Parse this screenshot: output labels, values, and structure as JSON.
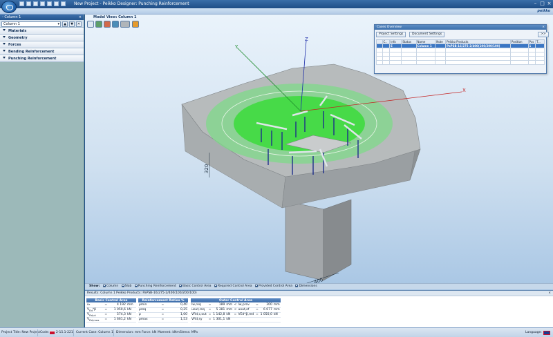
{
  "window": {
    "title": "New Project - Peikko Designer: Punching Reinforcement",
    "brand": "peikko"
  },
  "left_panel": {
    "header": "- Column 1",
    "close": "×",
    "selected_column": "Column 1",
    "sections": [
      "Materials",
      "Geometry",
      "Forces",
      "Bending Reinforcement",
      "Punching Reinforcement"
    ]
  },
  "model_view": {
    "tab_label": "Model View: Column 1",
    "axis_labels": {
      "x": "X",
      "y": "Y",
      "z": "Z"
    },
    "dimensions": {
      "slab_thickness": "320",
      "column_width": "400"
    }
  },
  "cases_overview": {
    "title": "Cases Overview",
    "close": "×",
    "buttons": {
      "project_settings": "Project Settings",
      "document_settings": "Document Settings",
      "more": ">>"
    },
    "columns": [
      "C..",
      "Info",
      "Status",
      "Name",
      "Note",
      "Peikko Products",
      "Position",
      "Pcs",
      "T..."
    ],
    "rows": [
      [
        "",
        "E",
        "",
        "Column 1",
        "",
        "PaPSB-16/275-2/400(100/200/100)",
        "",
        "1",
        ""
      ]
    ]
  },
  "show_bar": {
    "label": "Show:",
    "options": [
      "Column",
      "Slab",
      "Punching Reinforcement",
      "Basic Control Area",
      "Required Control Area",
      "Provided Control Area",
      "Dimensions"
    ]
  },
  "results": {
    "header": "Results: Column 1   Peikko Products: PaPSB-16/275-2/400(100/200/100)",
    "close": "×",
    "basic": {
      "title": "Basic Control Area",
      "rows": [
        [
          "u₁",
          "=",
          "4 192",
          "mm"
        ],
        [
          "V<sub>Ed</sub>*β",
          "=",
          "1 050,6",
          "kN"
        ],
        [
          "V<sub>Rd,ct</sub>",
          "=",
          "574,3",
          "kN"
        ],
        [
          "V<sub>Rd,max</sub>",
          "=",
          "1 661,2",
          "kN"
        ]
      ]
    },
    "ratios": {
      "title": "Reinforcement Ratios %",
      "rows": [
        [
          "ρmin",
          "=",
          "0,40"
        ],
        [
          "ρreq",
          "=",
          "0,25"
        ],
        [
          "ρ",
          "=",
          "1,00"
        ],
        [
          "ρmax",
          "=",
          "1,53"
        ]
      ]
    },
    "outer": {
      "title": "Outer Control Area",
      "rows": [
        [
          "lw,req",
          "=",
          "189",
          "mm",
          "<",
          "lw,prov",
          "=",
          "300",
          "mm"
        ],
        [
          "uout,req",
          "=",
          "5 381",
          "mm",
          "<",
          "uout,ef",
          "=",
          "6 077",
          "mm"
        ],
        [
          "VRd,c,out",
          "=",
          "1 142,8",
          "kN",
          "=",
          "VEd*β,red",
          "=",
          "1 050,0",
          "kN"
        ],
        [
          "VRd,sy",
          "=",
          "1 301,1",
          "kN",
          "",
          "",
          "",
          "",
          ""
        ]
      ]
    }
  },
  "status_bar": {
    "project": "Project Title: New Project",
    "code_label": "Code:",
    "code_value": "2-15.1-221",
    "current_case": "Current Case: Column 1",
    "dimension": "Dimension: mm",
    "force": "Force: kN",
    "moment": "Moment: kNm",
    "stress": "Stress: MPa",
    "language": "Language:"
  },
  "colors": {
    "title_bar": "#2a5d99",
    "left_panel_bg": "#9cb9b9",
    "control_area": "#3bdc3b",
    "slab": "#8c8f90"
  }
}
